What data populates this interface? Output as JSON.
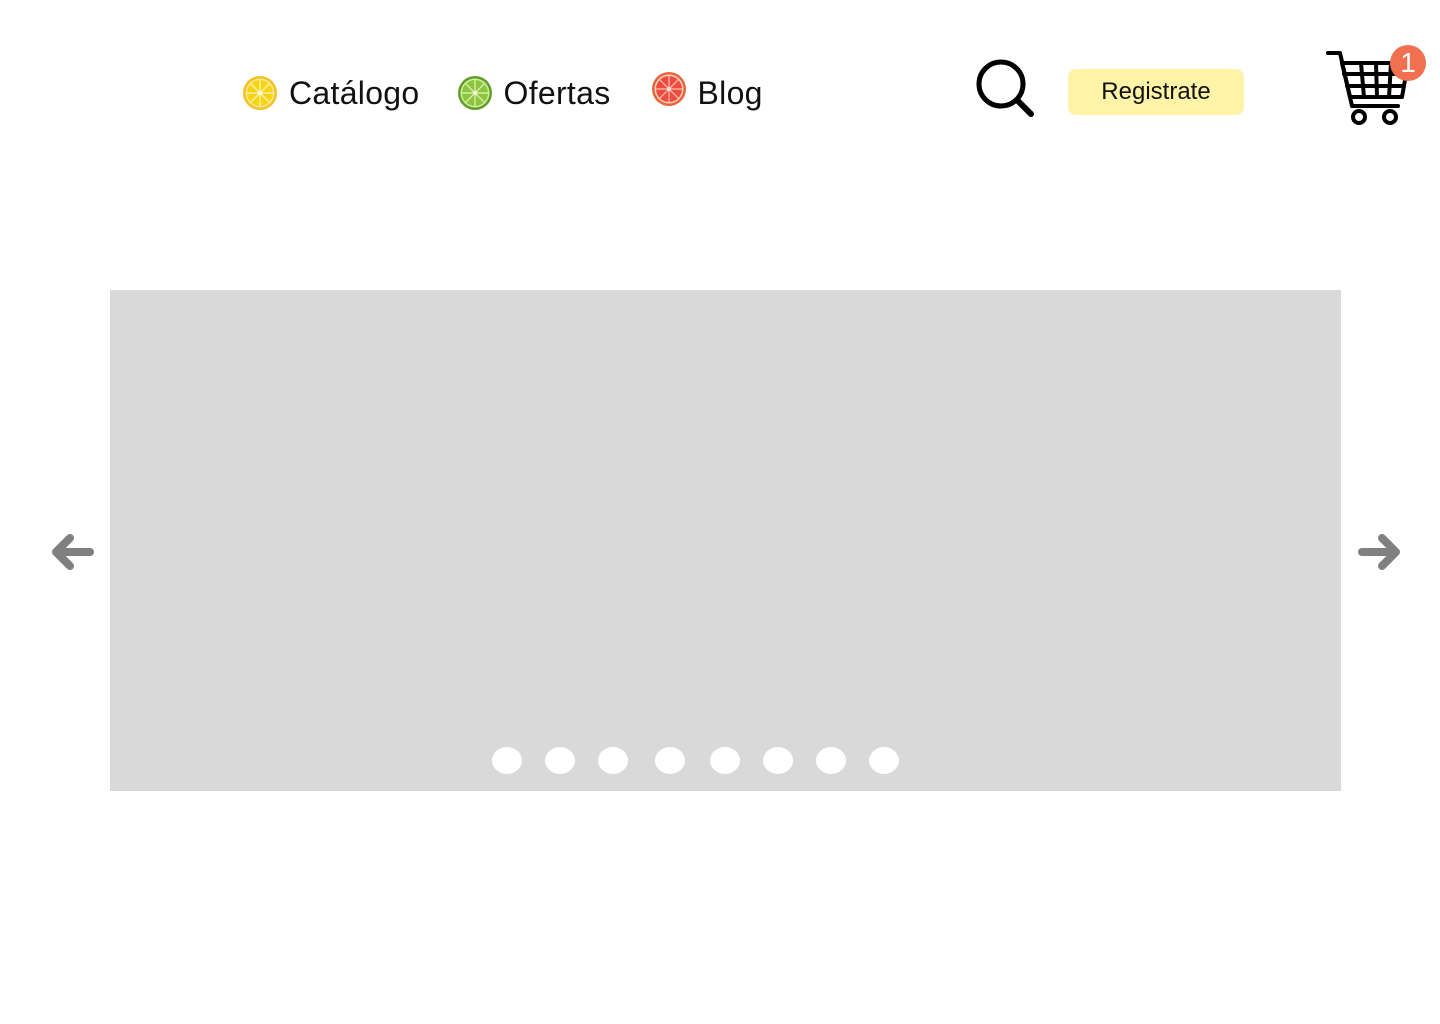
{
  "nav": {
    "items": [
      {
        "label": "Catálogo",
        "icon": "lemon-icon"
      },
      {
        "label": "Ofertas",
        "icon": "lime-icon"
      },
      {
        "label": "Blog",
        "icon": "grapefruit-icon"
      }
    ]
  },
  "header": {
    "search_icon": "search-icon",
    "register_label": "Registrate",
    "cart_icon": "shopping-cart-icon",
    "cart_count": "1"
  },
  "carousel": {
    "slide_count": 8,
    "prev_icon": "arrow-left-icon",
    "next_icon": "arrow-right-icon"
  },
  "colors": {
    "register_bg": "#fff3a8",
    "badge_bg": "#f07050",
    "carousel_bg": "#d9d9d9",
    "arrow": "#808080",
    "lemon": "#f5d20c",
    "lime": "#86c440",
    "grapefruit": "#ef5a45"
  }
}
